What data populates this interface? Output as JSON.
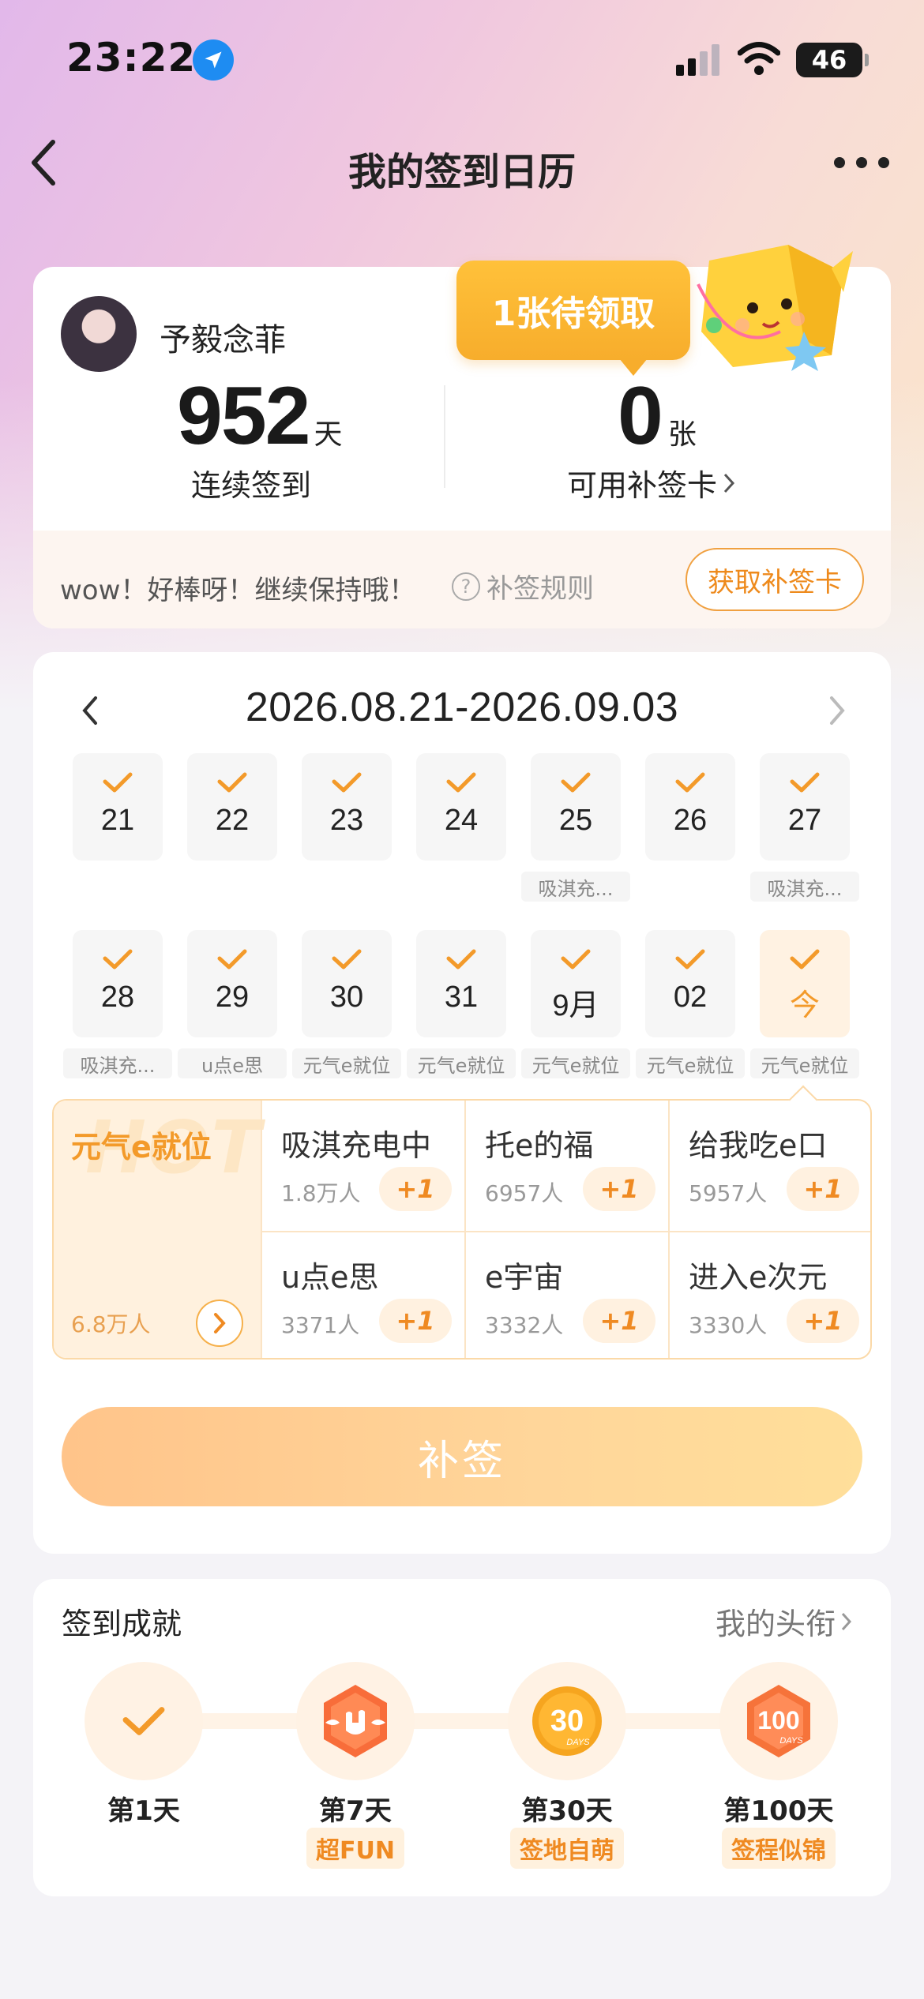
{
  "status_bar": {
    "time": "23:22",
    "battery": "46"
  },
  "nav": {
    "title": "我的签到日历"
  },
  "profile": {
    "username": "予毅念菲",
    "streak_days": "952",
    "streak_unit": "天",
    "streak_label": "连续签到",
    "cards_count": "0",
    "cards_unit": "张",
    "cards_label": "可用补签卡",
    "pending_bubble": "1张待领取",
    "encourage_text": "wow！好棒呀！继续保持哦！",
    "rule_link": "补签规则",
    "get_card_button": "获取补签卡"
  },
  "calendar": {
    "range": "2026.08.21-2026.09.03",
    "week1": [
      {
        "day": "21",
        "tag": ""
      },
      {
        "day": "22",
        "tag": ""
      },
      {
        "day": "23",
        "tag": ""
      },
      {
        "day": "24",
        "tag": ""
      },
      {
        "day": "25",
        "tag": "吸淇充..."
      },
      {
        "day": "26",
        "tag": ""
      },
      {
        "day": "27",
        "tag": "吸淇充..."
      }
    ],
    "week2": [
      {
        "day": "28",
        "tag": "吸淇充..."
      },
      {
        "day": "29",
        "tag": "u点e思"
      },
      {
        "day": "30",
        "tag": "元气e就位"
      },
      {
        "day": "31",
        "tag": "元气e就位"
      },
      {
        "day": "9月",
        "tag": "元气e就位"
      },
      {
        "day": "02",
        "tag": "元气e就位"
      },
      {
        "day": "今",
        "tag": "元气e就位"
      }
    ]
  },
  "topics": {
    "hot_bg": "HOT",
    "hot": {
      "name": "元气e就位",
      "count": "6.8万人"
    },
    "items": [
      {
        "name": "吸淇充电中",
        "count": "1.8万人",
        "plus": "+1"
      },
      {
        "name": "托e的福",
        "count": "6957人",
        "plus": "+1"
      },
      {
        "name": "给我吃e口",
        "count": "5957人",
        "plus": "+1"
      },
      {
        "name": "u点e思",
        "count": "3371人",
        "plus": "+1"
      },
      {
        "name": "e宇宙",
        "count": "3332人",
        "plus": "+1"
      },
      {
        "name": "进入e次元",
        "count": "3330人",
        "plus": "+1"
      }
    ]
  },
  "makeup_button": "补签",
  "achievements": {
    "title": "签到成就",
    "link": "我的头衔",
    "items": [
      {
        "label": "第1天",
        "tag": ""
      },
      {
        "label": "第7天",
        "tag": "超FUN"
      },
      {
        "label": "第30天",
        "tag": "签地自萌"
      },
      {
        "label": "第100天",
        "tag": "签程似锦"
      }
    ]
  },
  "colors": {
    "accent": "#f39a2a",
    "bubble": "#f7ad2c",
    "button": "#ffc48a"
  },
  "icons": [
    "location-arrow-icon",
    "signal-icon",
    "wifi-icon",
    "back-chevron-icon",
    "more-dots-icon",
    "check-icon",
    "chevron-right-icon",
    "question-circle-icon",
    "badge-hand-icon",
    "badge-30-days-icon",
    "badge-100-days-icon"
  ]
}
